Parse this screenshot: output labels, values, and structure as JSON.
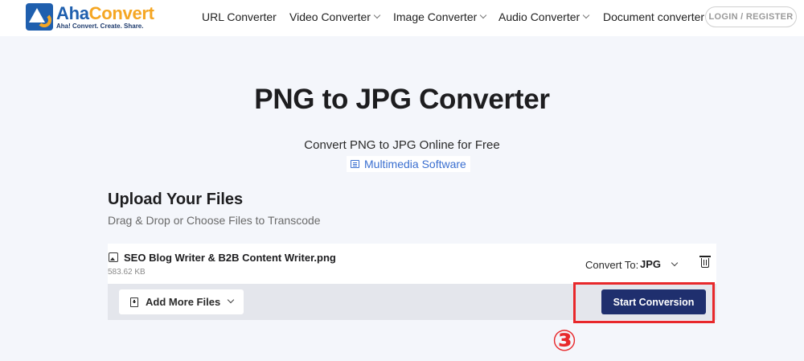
{
  "brand": {
    "name_part1": "Aha",
    "name_part2": "Convert",
    "tagline": "Aha! Convert. Create. Share."
  },
  "nav": {
    "items": [
      {
        "label": "URL Converter",
        "has_dropdown": false
      },
      {
        "label": "Video Converter",
        "has_dropdown": true
      },
      {
        "label": "Image Converter",
        "has_dropdown": true
      },
      {
        "label": "Audio Converter",
        "has_dropdown": true
      },
      {
        "label": "Document converter",
        "has_dropdown": false
      }
    ],
    "login_label": "LOGIN / REGISTER"
  },
  "hero": {
    "title": "PNG to JPG Converter",
    "subtitle": "Convert PNG to JPG Online for Free",
    "link_label": "Multimedia Software"
  },
  "upload": {
    "title": "Upload Your Files",
    "subtitle": "Drag & Drop or Choose Files to Transcode"
  },
  "file": {
    "name": "SEO Blog Writer & B2B Content Writer.png",
    "size": "583.62 KB",
    "convert_to_label": "Convert To:",
    "format": "JPG"
  },
  "actions": {
    "add_more_label": "Add More Files",
    "start_label": "Start Conversion"
  },
  "annotation": {
    "step_marker": "③",
    "color": "#e8282b"
  },
  "colors": {
    "primary": "#1f2f6e",
    "brand_blue": "#1f5fae",
    "brand_orange": "#f5a623",
    "link": "#3a6fd0",
    "background": "#f4f6fb"
  },
  "icons": [
    "logo-icon",
    "chevron-down-icon",
    "document-list-icon",
    "image-file-icon",
    "trash-icon",
    "add-file-icon"
  ]
}
